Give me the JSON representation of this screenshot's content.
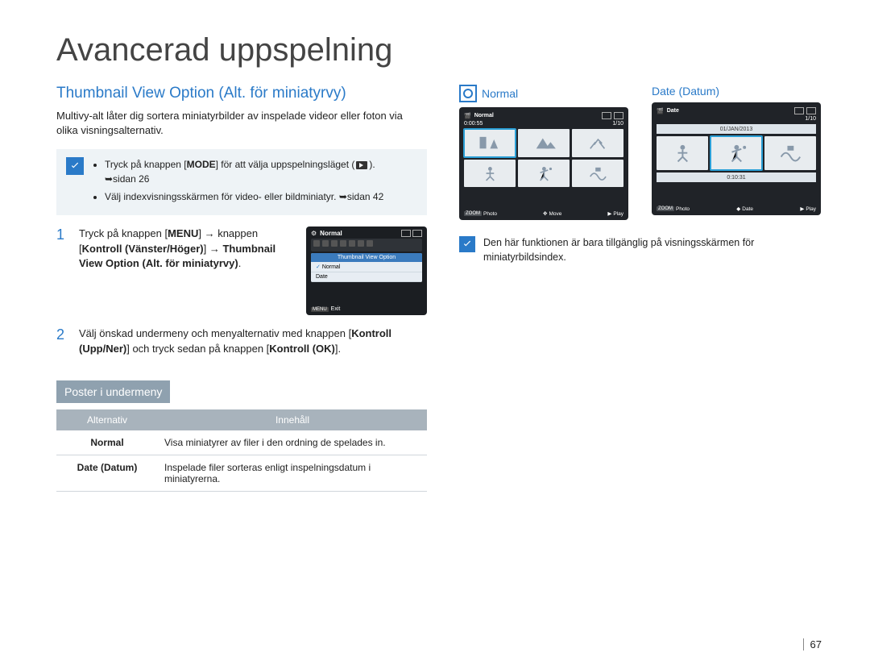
{
  "chapter": "Avancerad uppspelning",
  "section_title": "Thumbnail View Option (Alt. för miniatyrvy)",
  "intro": "Multivy-alt låter dig sortera miniatyrbilder av inspelade videor eller foton via olika visningsalternativ.",
  "notebox": {
    "items": [
      {
        "pre": "Tryck på knappen [",
        "bold": "MODE",
        "post": "] för att välja uppspelningsläget (",
        "ref": "➥sidan 26"
      },
      {
        "text": "Välj indexvisningsskärmen för video- eller bildminiatyr.",
        "ref": "➥sidan 42"
      }
    ]
  },
  "steps": [
    {
      "num": "1",
      "pre": "Tryck på knappen [",
      "b1": "MENU",
      "mid1": "] → knappen [",
      "b2": "Kontroll (Vänster/Höger)",
      "mid2": "] → ",
      "b3": "Thumbnail View Option (Alt. för miniatyrvy)",
      "post": "."
    },
    {
      "num": "2",
      "pre": "Välj önskad undermeny och menyalternativ med knappen [",
      "b1": "Kontroll (Upp/Ner)",
      "mid1": "] och tryck sedan på knappen [",
      "b2": "Kontroll (OK)",
      "post": "]."
    }
  ],
  "menu_fig": {
    "header": "Normal",
    "title": "Thumbnail View Option",
    "opt_sel": "Normal",
    "opt2": "Date",
    "exit_key": "MENU",
    "exit": "Exit"
  },
  "sub_heading": "Poster i undermeny",
  "table": {
    "head": {
      "c1": "Alternativ",
      "c2": "Innehåll"
    },
    "rows": [
      {
        "c1": "Normal",
        "c2": "Visa miniatyrer av filer i den ordning de spelades in."
      },
      {
        "c1": "Date (Datum)",
        "c2": "Inspelade filer sorteras enligt inspelningsdatum i miniatyrerna."
      }
    ]
  },
  "thumbs": {
    "normal": {
      "label": "Normal",
      "hdr": "Normal",
      "time": "0:00:55",
      "count": "1/10",
      "btm": {
        "zoom": "ZOOM",
        "photo": "Photo",
        "move": "Move",
        "play": "Play"
      }
    },
    "date": {
      "label": "Date (Datum)",
      "hdr": "Date",
      "bar1": "01/JAN/2013",
      "count": "1/10",
      "bar2": "0:10:31",
      "btm": {
        "zoom": "ZOOM",
        "photo": "Photo",
        "date": "Date",
        "play": "Play"
      }
    }
  },
  "footnote": "Den här funktionen är bara tillgänglig på visningsskärmen för miniatyrbildsindex.",
  "page_number": "67"
}
